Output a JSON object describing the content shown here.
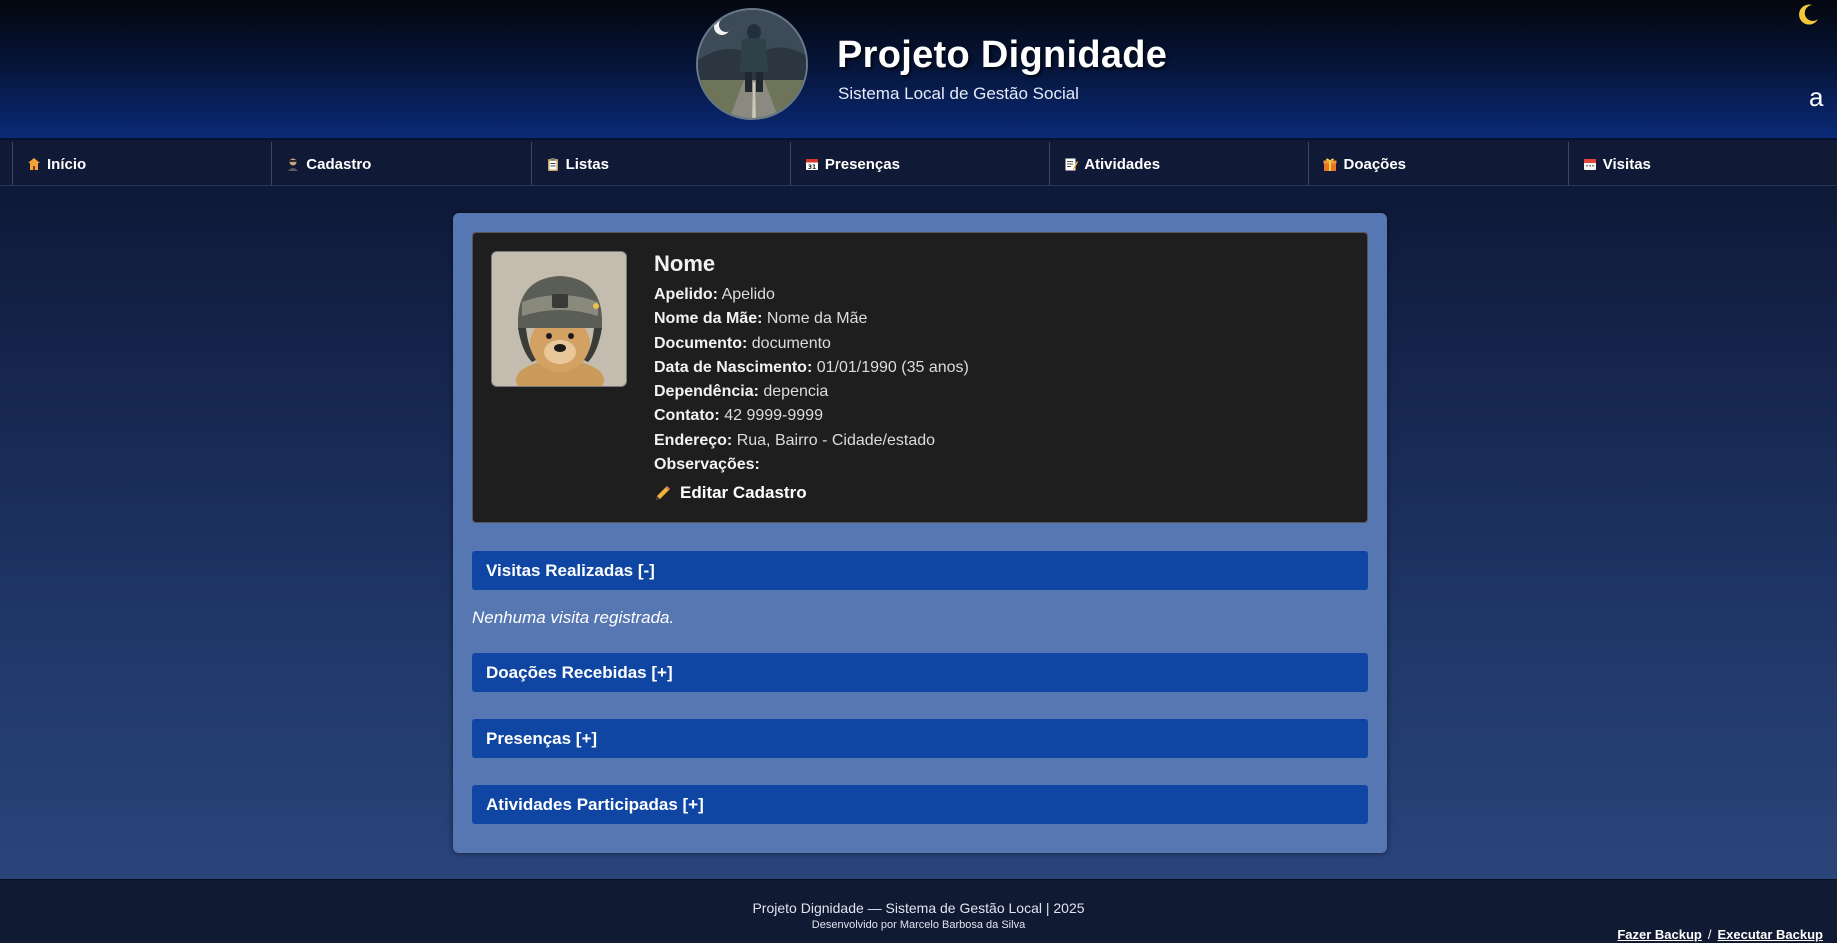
{
  "header": {
    "title": "Projeto Dignidade",
    "subtitle": "Sistema Local de Gestão Social",
    "theme_toggle_icon": "moon-icon",
    "corner_letter": "a"
  },
  "nav": {
    "items": [
      {
        "label": "Início",
        "icon": "home-icon"
      },
      {
        "label": "Cadastro",
        "icon": "person-icon"
      },
      {
        "label": "Listas",
        "icon": "clipboard-icon"
      },
      {
        "label": "Presenças",
        "icon": "calendar-icon"
      },
      {
        "label": "Atividades",
        "icon": "memo-icon"
      },
      {
        "label": "Doações",
        "icon": "gift-icon"
      },
      {
        "label": "Visitas",
        "icon": "calendar-tearoff-icon"
      }
    ]
  },
  "profile": {
    "name": "Nome",
    "fields": [
      {
        "label": "Apelido:",
        "value": "Apelido"
      },
      {
        "label": "Nome da Mãe:",
        "value": "Nome da Mãe"
      },
      {
        "label": "Documento:",
        "value": "documento"
      },
      {
        "label": "Data de Nascimento:",
        "value": "01/01/1990 (35 anos)"
      },
      {
        "label": "Dependência:",
        "value": "depencia"
      },
      {
        "label": "Contato:",
        "value": "42 9999-9999"
      },
      {
        "label": "Endereço:",
        "value": "Rua, Bairro - Cidade/estado"
      },
      {
        "label": "Observações:",
        "value": ""
      }
    ],
    "edit_label": "Editar Cadastro"
  },
  "sections": {
    "visitas": "Visitas Realizadas [-]",
    "visitas_empty": "Nenhuma visita registrada.",
    "doacoes": "Doações Recebidas [+]",
    "presencas": "Presenças [+]",
    "atividades": "Atividades Participadas [+]"
  },
  "footer": {
    "line1": "Projeto Dignidade — Sistema de Gestão Local | 2025",
    "line2": "Desenvolvido por Marcelo Barbosa da Silva",
    "backup": "Fazer Backup",
    "separator": "/",
    "run_backup": "Executar Backup"
  },
  "colors": {
    "header_bg": "#061436",
    "nav_bg": "#101a36",
    "card_bg": "#5677b2",
    "profile_bg": "#1e1e1e",
    "section_bar": "#0f46a3",
    "footer_bg": "#111a33"
  }
}
